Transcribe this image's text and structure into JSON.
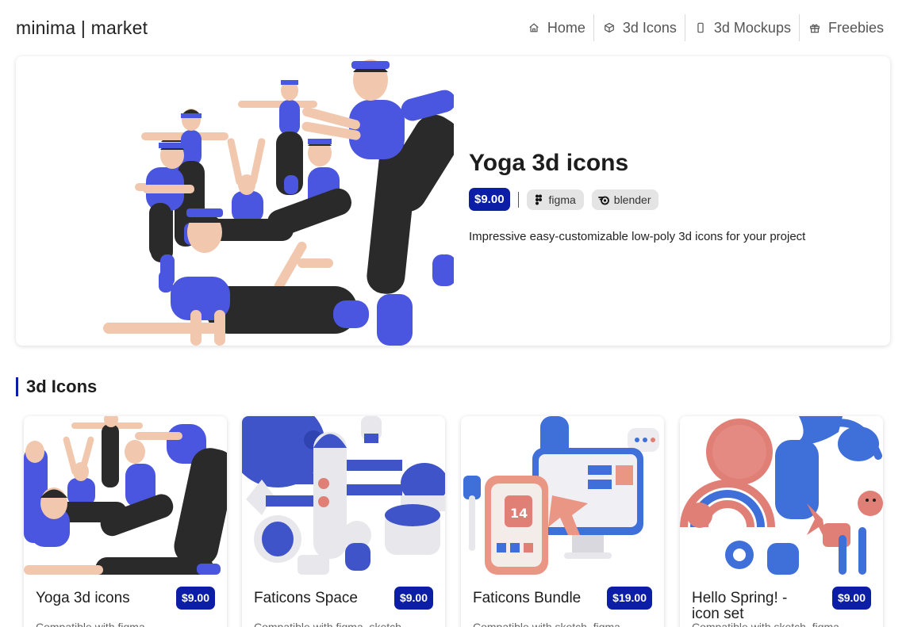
{
  "header": {
    "logo": "minima | market",
    "nav": [
      {
        "label": "Home",
        "icon": "home-icon"
      },
      {
        "label": "3d Icons",
        "icon": "cube-icon"
      },
      {
        "label": "3d Mockups",
        "icon": "phone-icon"
      },
      {
        "label": "Freebies",
        "icon": "gift-icon"
      }
    ]
  },
  "hero": {
    "title": "Yoga 3d icons",
    "price": "$9.00",
    "tools": [
      {
        "label": "figma",
        "icon": "figma-icon"
      },
      {
        "label": "blender",
        "icon": "blender-icon"
      }
    ],
    "description": "Impressive easy-customizable low-poly 3d icons for your project"
  },
  "section": {
    "title": "3d Icons"
  },
  "cards": [
    {
      "title": "Yoga 3d icons",
      "price": "$9.00",
      "description": "Compatible with figma"
    },
    {
      "title": "Faticons Space",
      "price": "$9.00",
      "description": "Compatible with figma, sketch"
    },
    {
      "title": "Faticons Bundle",
      "price": "$19.00",
      "description": "Compatible with sketch, figma"
    },
    {
      "title": "Hello Spring! - icon set",
      "price": "$9.00",
      "description": "Compatible with sketch, figma"
    }
  ],
  "colors": {
    "accent": "#0d1ea6",
    "figure_blue": "#4a55e0",
    "figure_dark": "#2a2a2a",
    "skin": "#f1c7ae",
    "coral": "#e07f76"
  }
}
